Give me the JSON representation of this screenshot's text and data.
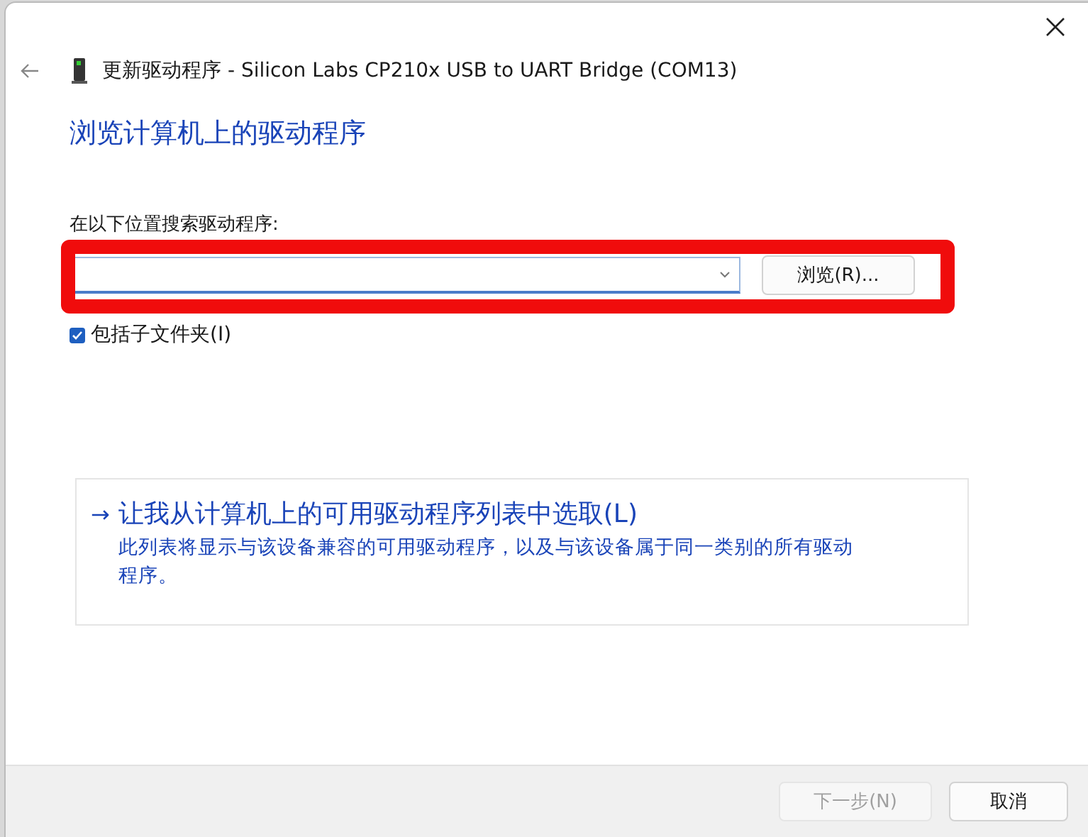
{
  "window": {
    "title": "更新驱动程序 - Silicon Labs CP210x USB to UART Bridge (COM13)"
  },
  "heading": "浏览计算机上的驱动程序",
  "search_location": {
    "label": "在以下位置搜索驱动程序:",
    "browse_button": "浏览(R)..."
  },
  "include_subfolders": {
    "label": "包括子文件夹(I)",
    "checked": true
  },
  "pick_from_list": {
    "arrow": "→",
    "title": "让我从计算机上的可用驱动程序列表中选取(L)",
    "description": "此列表将显示与该设备兼容的可用驱动程序，以及与该设备属于同一类别的所有驱动程序。"
  },
  "buttons": [
    {
      "label": "下一步(N)",
      "disabled": true
    },
    {
      "label": "取消",
      "disabled": false
    }
  ]
}
